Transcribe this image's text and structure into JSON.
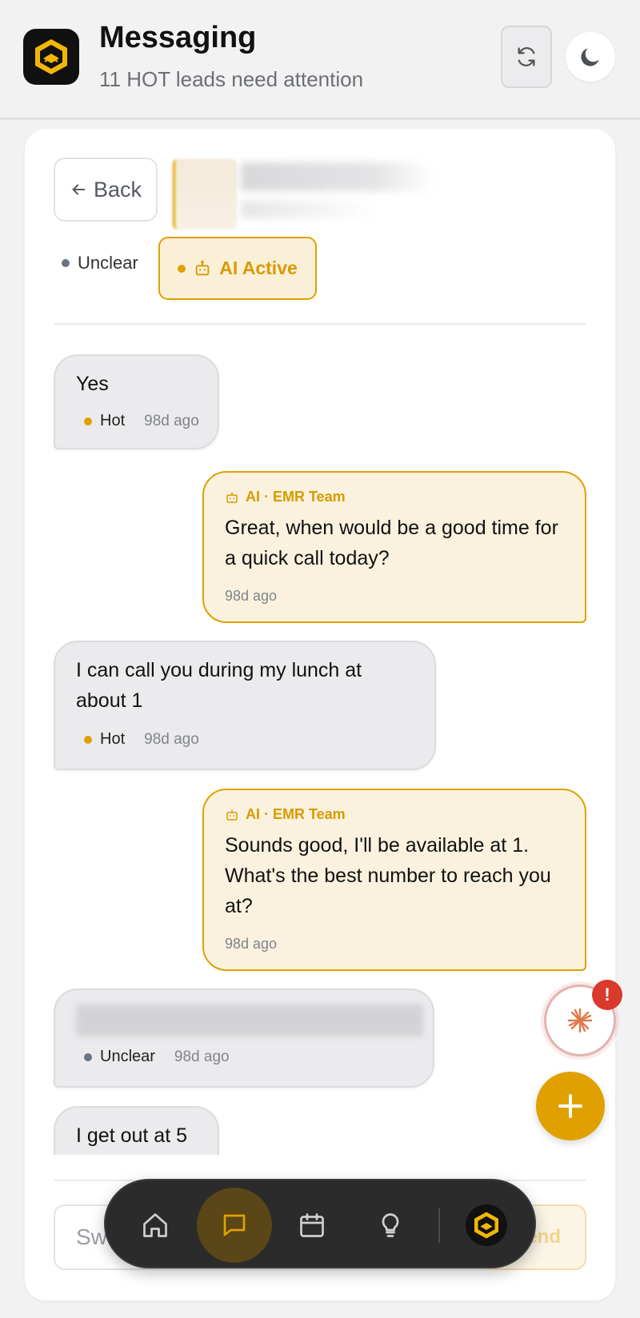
{
  "header": {
    "title": "Messaging",
    "subtitle": "11 HOT leads need attention"
  },
  "conversation": {
    "back_label": "Back",
    "status_label": "Unclear",
    "ai_status_label": "AI Active",
    "messages": [
      {
        "direction": "in",
        "text": "Yes",
        "status": "Hot",
        "time": "98d ago"
      },
      {
        "direction": "out",
        "sender": "AI · EMR Team",
        "text": "Great, when would be a good time for a quick call today?",
        "time": "98d ago"
      },
      {
        "direction": "in",
        "text": "I can call you during my lunch at about 1",
        "status": "Hot",
        "time": "98d ago"
      },
      {
        "direction": "out",
        "sender": "AI · EMR Team",
        "text": "Sounds good, I'll be available at 1. What's the best number to reach you at?",
        "time": "98d ago"
      },
      {
        "direction": "in",
        "text": "",
        "status": "Unclear",
        "time": "98d ago"
      },
      {
        "direction": "in",
        "text": "I get out at 5"
      }
    ]
  },
  "composer": {
    "placeholder": "Sw",
    "send_label": "Send"
  },
  "fab": {
    "alert_badge": "!"
  },
  "colors": {
    "accent": "#e0a100",
    "alert": "#d93a2b",
    "nav_bg": "#2b2b2c"
  },
  "icons": [
    "app-logo-icon",
    "refresh-icon",
    "moon-icon",
    "arrow-left-icon",
    "robot-icon",
    "sparkle-icon",
    "plus-icon",
    "home-icon",
    "chat-icon",
    "calendar-icon",
    "lightbulb-icon"
  ]
}
